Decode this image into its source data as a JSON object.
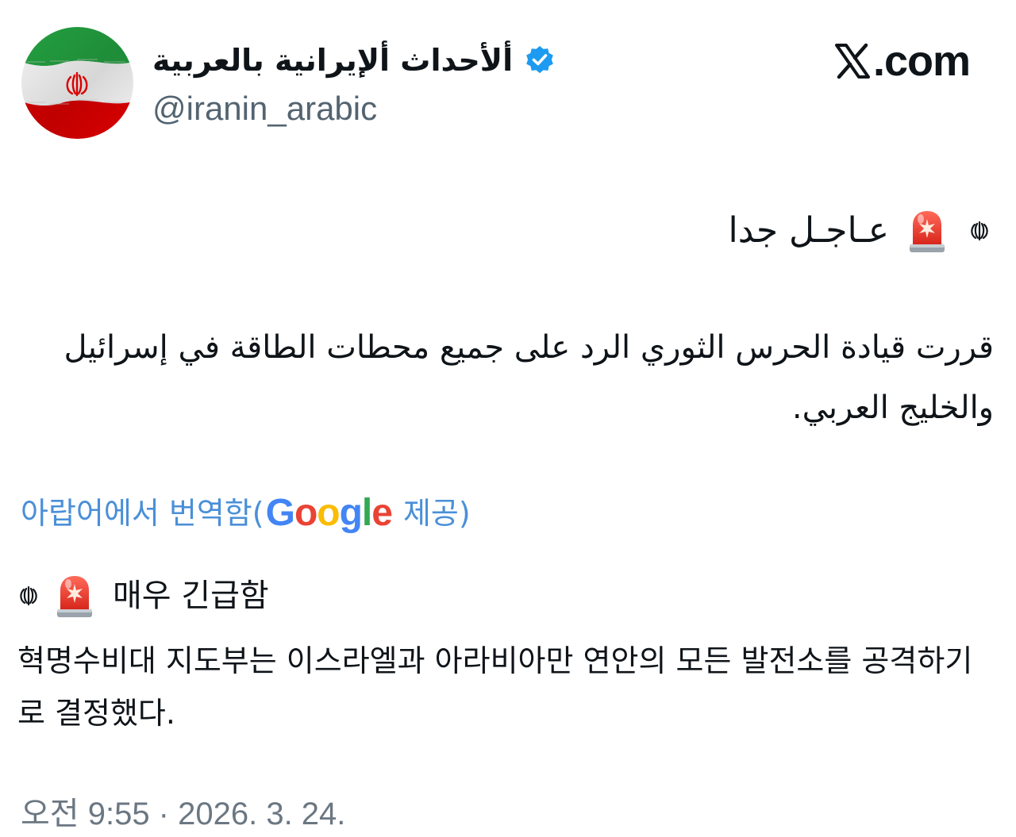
{
  "header": {
    "display_name": "ألأحداث ألإيرانية بالعربية",
    "handle": "@iranin_arabic",
    "brand": "𝕏.com",
    "brand_text": ".com",
    "avatar_icon": "iran-flag-icon",
    "verified_icon": "verified-badge-icon",
    "colors": {
      "flag_green": "#239f40",
      "flag_white": "#ffffff",
      "flag_red": "#da0000",
      "verified_blue": "#1d9bf0"
    }
  },
  "post": {
    "arabic": {
      "headline": "عـاجـل جدا",
      "body": "قررت قيادة الحرس الثوري الرد على جميع محطات الطاقة في إسرائيل والخليج العربي.",
      "icons": [
        "iran-emblem-icon",
        "siren-icon"
      ]
    },
    "translation": {
      "prefix": "아랍어에서 번역함(",
      "provider": "Google",
      "suffix": "제공)",
      "colors": {
        "link": "#4a8fd8",
        "google_blue": "#4285F4",
        "google_red": "#EA4335",
        "google_yellow": "#FBBC05",
        "google_green": "#34A853"
      }
    },
    "korean": {
      "headline": "매우 긴급함",
      "body": "혁명수비대 지도부는 이스라엘과 아라비아만 연안의 모든 발전소를 공격하기로 결정했다."
    },
    "timestamp": "오전 9:55 · 2026. 3. 24."
  }
}
